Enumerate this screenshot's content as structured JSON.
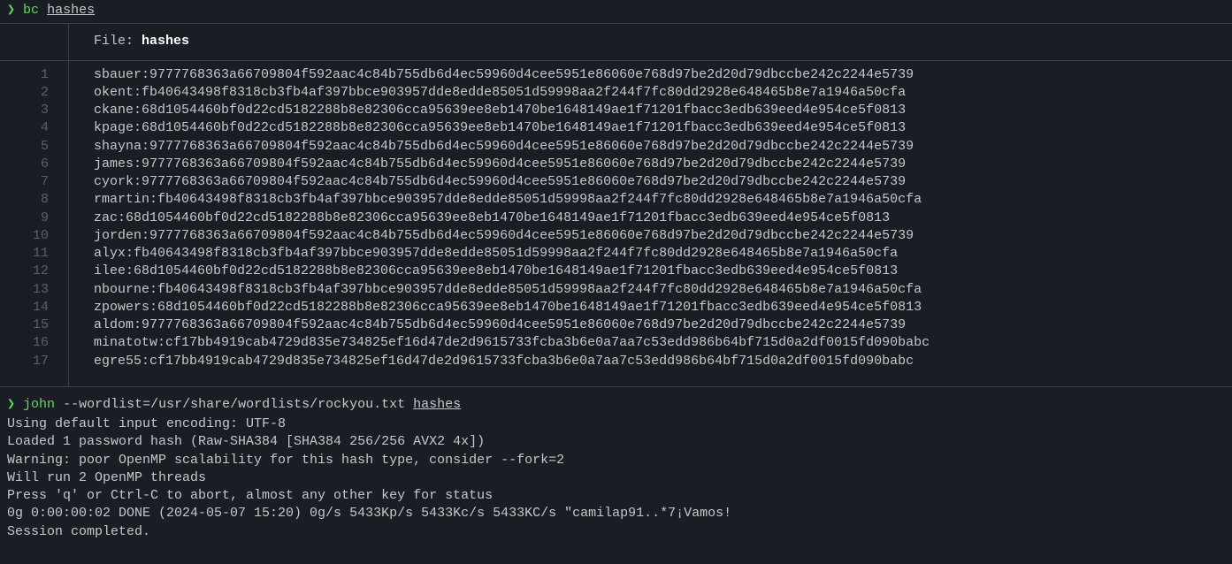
{
  "prompt1": {
    "arrow": "❯",
    "cmd": "bc",
    "arg": "hashes"
  },
  "file": {
    "label": "File: ",
    "name": "hashes",
    "lines": [
      "sbauer:9777768363a66709804f592aac4c84b755db6d4ec59960d4cee5951e86060e768d97be2d20d79dbccbe242c2244e5739",
      "okent:fb40643498f8318cb3fb4af397bbce903957dde8edde85051d59998aa2f244f7fc80dd2928e648465b8e7a1946a50cfa",
      "ckane:68d1054460bf0d22cd5182288b8e82306cca95639ee8eb1470be1648149ae1f71201fbacc3edb639eed4e954ce5f0813",
      "kpage:68d1054460bf0d22cd5182288b8e82306cca95639ee8eb1470be1648149ae1f71201fbacc3edb639eed4e954ce5f0813",
      "shayna:9777768363a66709804f592aac4c84b755db6d4ec59960d4cee5951e86060e768d97be2d20d79dbccbe242c2244e5739",
      "james:9777768363a66709804f592aac4c84b755db6d4ec59960d4cee5951e86060e768d97be2d20d79dbccbe242c2244e5739",
      "cyork:9777768363a66709804f592aac4c84b755db6d4ec59960d4cee5951e86060e768d97be2d20d79dbccbe242c2244e5739",
      "rmartin:fb40643498f8318cb3fb4af397bbce903957dde8edde85051d59998aa2f244f7fc80dd2928e648465b8e7a1946a50cfa",
      "zac:68d1054460bf0d22cd5182288b8e82306cca95639ee8eb1470be1648149ae1f71201fbacc3edb639eed4e954ce5f0813",
      "jorden:9777768363a66709804f592aac4c84b755db6d4ec59960d4cee5951e86060e768d97be2d20d79dbccbe242c2244e5739",
      "alyx:fb40643498f8318cb3fb4af397bbce903957dde8edde85051d59998aa2f244f7fc80dd2928e648465b8e7a1946a50cfa",
      "ilee:68d1054460bf0d22cd5182288b8e82306cca95639ee8eb1470be1648149ae1f71201fbacc3edb639eed4e954ce5f0813",
      "nbourne:fb40643498f8318cb3fb4af397bbce903957dde8edde85051d59998aa2f244f7fc80dd2928e648465b8e7a1946a50cfa",
      "zpowers:68d1054460bf0d22cd5182288b8e82306cca95639ee8eb1470be1648149ae1f71201fbacc3edb639eed4e954ce5f0813",
      "aldom:9777768363a66709804f592aac4c84b755db6d4ec59960d4cee5951e86060e768d97be2d20d79dbccbe242c2244e5739",
      "minatotw:cf17bb4919cab4729d835e734825ef16d47de2d9615733fcba3b6e0a7aa7c53edd986b64bf715d0a2df0015fd090babc",
      "egre55:cf17bb4919cab4729d835e734825ef16d47de2d9615733fcba3b6e0a7aa7c53edd986b64bf715d0a2df0015fd090babc"
    ]
  },
  "prompt2": {
    "arrow": "❯",
    "cmd": "john",
    "flags": "--wordlist=/usr/share/wordlists/rockyou.txt",
    "arg": "hashes"
  },
  "output": [
    "Using default input encoding: UTF-8",
    "Loaded 1 password hash (Raw-SHA384 [SHA384 256/256 AVX2 4x])",
    "Warning: poor OpenMP scalability for this hash type, consider --fork=2",
    "Will run 2 OpenMP threads",
    "Press 'q' or Ctrl-C to abort, almost any other key for status",
    "0g 0:00:00:02 DONE (2024-05-07 15:20) 0g/s 5433Kp/s 5433Kc/s 5433KC/s \"camilap91..*7¡Vamos!",
    "Session completed."
  ]
}
